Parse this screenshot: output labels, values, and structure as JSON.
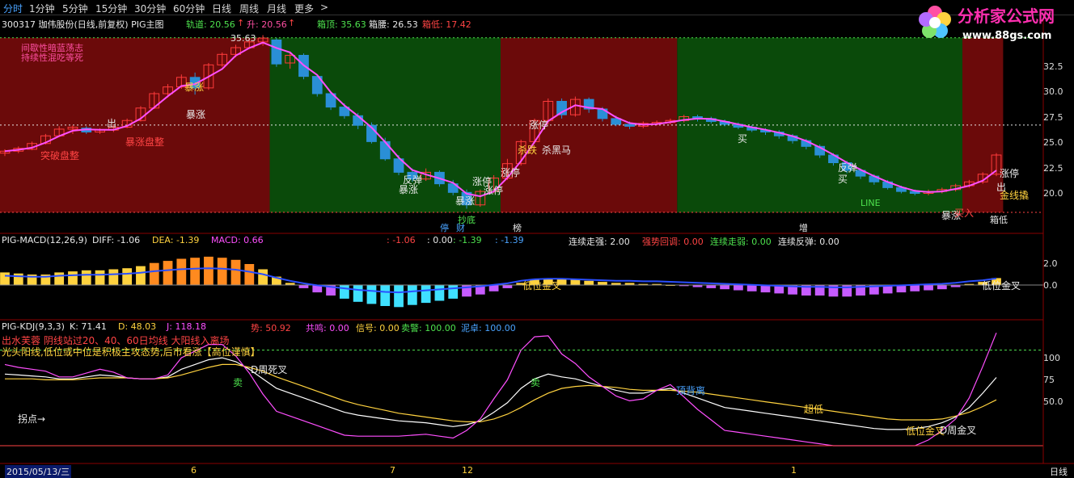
{
  "toolbar": {
    "items": [
      "分时",
      "1分钟",
      "5分钟",
      "15分钟",
      "30分钟",
      "60分钟",
      "日线",
      "周线",
      "月线",
      "更多"
    ],
    "active_index": 0,
    "more_arrow": ">"
  },
  "logo": {
    "brand": "分析家公式网",
    "url": "www.88gs.com"
  },
  "main_header": {
    "code_name": "300317 珈伟股份(日线,前复权) PIG主图",
    "track_label": "轨道: 20.56",
    "up_label": "升: 20.56",
    "box_top": "箱顶: 35.63",
    "box_mid": "箱腰: 26.53",
    "box_low": "箱低: 17.42",
    "up_arrow": "↑"
  },
  "macd_header": {
    "name": "PIG-MACD(12,26,9)",
    "diff": "DIFF: -1.06",
    "dea": "DEA: -1.39",
    "macd": "MACD: 0.66",
    "v1": ": -1.06",
    "v2": ": 0.00",
    "v3": ": -1.39",
    "v4": ": -1.39",
    "s1": "连续走强: 2.00",
    "s2": "强势回调: 0.00",
    "s3": "连续走弱: 0.00",
    "s4": "连续反弹: 0.00"
  },
  "kdj_header": {
    "name": "PIG-KDJ(9,3,3)",
    "k": "K: 71.41",
    "d": "D: 48.03",
    "j": "J: 118.18",
    "shi": "势: 50.92",
    "gongming": "共鸣: 0.00",
    "xinhao": "信号: 0.00",
    "maijing": "卖警: 100.00",
    "nizhuo": "泥卓: 100.00"
  },
  "main_annotations": {
    "intermittent1": "间歇性暗蓝荡志",
    "intermittent2": "持续性混吃等死",
    "breakout": "突破盘整",
    "surge_consol": "暴涨盘整",
    "out1": "出",
    "surge1": "暴涨",
    "surge_top": "暴涨",
    "peak": "35.63",
    "rebound": "反弹",
    "surge2": "暴涨",
    "surge3": "暴涨",
    "limit_up1": "涨停",
    "limit_up2": "涨停",
    "limit_up3": "涨停",
    "limit_up4": "涨停",
    "fall": "杀跌",
    "rebound_black": "杀黑马",
    "buy1": "买",
    "buy2": "买",
    "rebound2": "反弹",
    "line": "LINE",
    "surge4": "暴涨",
    "limit_up5": "涨停",
    "out2": "出",
    "cross": "金线撬",
    "box_low_lbl": "箱低",
    "bottom": "抄底",
    "ting": "停",
    "cai": "财",
    "bang": "榜",
    "zeng": "增",
    "buy_in": "买入"
  },
  "macd_annotations": {
    "low_gold": "低位金叉",
    "low_gold2": "低位金叉"
  },
  "kdj_annotations": {
    "note1": "出水芙蓉 阴线站过20、40、60日均线 大阳线入离场",
    "note2": "光头阳线,低位或中位是积极主攻态势,后市看涨【高位谨慎】",
    "d_death": "D周死叉",
    "sell1": "卖",
    "sell2": "卖",
    "top_div": "顶背离",
    "super_low": "超低",
    "low_gold": "低位金叉",
    "d_gold": "D周金叉",
    "turn": "拐点→"
  },
  "axes": {
    "price_ticks": [
      "32.5",
      "30.0",
      "27.5",
      "25.0",
      "22.5",
      "20.0"
    ],
    "macd_ticks": [
      "2.0",
      "0.0"
    ],
    "kdj_ticks": [
      "100",
      "75",
      "50.0"
    ],
    "date_labels": [
      "2015/05/13/三",
      "6",
      "7",
      "12",
      "1"
    ],
    "period": "日线"
  },
  "chart_data": {
    "type": "candlestick",
    "price_axis": {
      "min": 17,
      "max": 36.2,
      "ticks": [
        20.0,
        22.5,
        25.0,
        27.5,
        30.0,
        32.5
      ]
    },
    "levels": {
      "box_top": 35.63,
      "box_mid": 26.53,
      "box_low": 17.42
    },
    "candles": [
      [
        23.6,
        23.8,
        23.3,
        24.0
      ],
      [
        23.8,
        24.1,
        23.6,
        24.3
      ],
      [
        24.0,
        24.6,
        23.9,
        24.8
      ],
      [
        24.6,
        25.4,
        24.5,
        25.6
      ],
      [
        25.4,
        26.1,
        25.3,
        26.4
      ],
      [
        26.1,
        26.3,
        25.6,
        26.5
      ],
      [
        26.2,
        25.8,
        25.6,
        26.4
      ],
      [
        25.8,
        26.0,
        25.6,
        26.2
      ],
      [
        26.0,
        26.3,
        25.8,
        26.5
      ],
      [
        26.3,
        27.0,
        26.2,
        27.2
      ],
      [
        27.0,
        28.3,
        26.9,
        28.5
      ],
      [
        28.3,
        29.8,
        28.2,
        30.0
      ],
      [
        29.8,
        30.5,
        29.4,
        30.8
      ],
      [
        30.5,
        31.5,
        30.3,
        31.8
      ],
      [
        31.5,
        30.4,
        29.7,
        32.0
      ],
      [
        30.4,
        32.8,
        30.2,
        33.0
      ],
      [
        32.8,
        33.9,
        32.6,
        34.1
      ],
      [
        33.9,
        34.6,
        33.6,
        34.9
      ],
      [
        34.6,
        35.2,
        34.5,
        35.6
      ],
      [
        35.2,
        35.6,
        34.8,
        35.9
      ],
      [
        35.4,
        32.9,
        32.6,
        35.6
      ],
      [
        33.0,
        33.8,
        32.4,
        34.2
      ],
      [
        33.8,
        31.6,
        31.3,
        34.0
      ],
      [
        31.6,
        29.8,
        29.5,
        31.8
      ],
      [
        29.8,
        28.4,
        28.1,
        30.0
      ],
      [
        28.4,
        27.5,
        27.2,
        28.8
      ],
      [
        27.5,
        26.5,
        26.1,
        27.8
      ],
      [
        26.5,
        24.8,
        24.6,
        26.8
      ],
      [
        24.8,
        23.0,
        22.8,
        25.2
      ],
      [
        23.0,
        21.6,
        21.3,
        23.4
      ],
      [
        21.6,
        20.9,
        20.6,
        22.0
      ],
      [
        20.9,
        21.6,
        20.7,
        22.0
      ],
      [
        21.6,
        20.4,
        20.1,
        21.8
      ],
      [
        20.4,
        19.5,
        19.2,
        20.8
      ],
      [
        19.5,
        18.2,
        17.8,
        19.8
      ],
      [
        18.2,
        19.6,
        18.0,
        19.8
      ],
      [
        19.6,
        21.0,
        19.4,
        21.3
      ],
      [
        21.0,
        22.5,
        20.8,
        23.0
      ],
      [
        22.5,
        24.8,
        22.3,
        25.0
      ],
      [
        24.8,
        27.0,
        24.6,
        27.2
      ],
      [
        27.0,
        29.0,
        26.6,
        29.3
      ],
      [
        29.0,
        27.6,
        27.2,
        29.3
      ],
      [
        27.6,
        29.2,
        27.4,
        29.5
      ],
      [
        29.2,
        28.2,
        27.8,
        29.4
      ],
      [
        28.2,
        27.2,
        26.9,
        28.4
      ],
      [
        27.2,
        26.6,
        26.4,
        27.5
      ],
      [
        26.6,
        26.4,
        26.1,
        26.9
      ],
      [
        26.4,
        26.7,
        26.2,
        26.9
      ],
      [
        26.7,
        26.8,
        26.5,
        27.0
      ],
      [
        26.8,
        27.0,
        26.6,
        27.2
      ],
      [
        27.0,
        27.4,
        26.8,
        27.6
      ],
      [
        27.4,
        27.2,
        26.9,
        27.6
      ],
      [
        27.2,
        26.9,
        26.7,
        27.4
      ],
      [
        26.9,
        26.6,
        26.4,
        27.1
      ],
      [
        26.6,
        26.3,
        26.1,
        26.8
      ],
      [
        26.3,
        26.0,
        25.8,
        26.5
      ],
      [
        26.0,
        25.8,
        25.5,
        26.2
      ],
      [
        25.8,
        25.4,
        25.1,
        26.0
      ],
      [
        25.4,
        24.9,
        24.6,
        25.6
      ],
      [
        24.9,
        24.3,
        24.0,
        25.1
      ],
      [
        24.3,
        23.4,
        23.1,
        24.5
      ],
      [
        23.4,
        22.6,
        22.3,
        23.6
      ],
      [
        22.6,
        21.8,
        21.5,
        22.8
      ],
      [
        21.8,
        21.2,
        20.9,
        22.0
      ],
      [
        21.2,
        20.6,
        20.3,
        21.4
      ],
      [
        20.6,
        20.0,
        19.8,
        20.8
      ],
      [
        20.0,
        19.6,
        19.4,
        20.2
      ],
      [
        19.6,
        19.4,
        19.2,
        19.8
      ],
      [
        19.4,
        19.6,
        19.2,
        19.8
      ],
      [
        19.6,
        19.8,
        19.4,
        20.0
      ],
      [
        19.8,
        20.2,
        19.6,
        20.4
      ],
      [
        20.2,
        20.6,
        20.0,
        20.8
      ],
      [
        20.6,
        21.4,
        20.4,
        21.6
      ],
      [
        21.4,
        23.4,
        21.2,
        23.6
      ]
    ],
    "macd": [
      1.2,
      1.1,
      1.0,
      1.0,
      1.2,
      1.3,
      1.4,
      1.4,
      1.5,
      1.6,
      1.8,
      2.1,
      2.3,
      2.5,
      2.6,
      2.7,
      2.6,
      2.4,
      2.0,
      1.5,
      0.8,
      0.2,
      -0.3,
      -0.7,
      -1.0,
      -1.3,
      -1.6,
      -1.8,
      -2.0,
      -2.1,
      -1.9,
      -1.7,
      -1.5,
      -1.3,
      -1.1,
      -0.9,
      -0.6,
      -0.3,
      0.2,
      0.5,
      0.6,
      0.6,
      0.5,
      0.4,
      0.3,
      0.2,
      0.2,
      0.1,
      0.1,
      0.0,
      -0.1,
      -0.2,
      -0.3,
      -0.4,
      -0.5,
      -0.6,
      -0.7,
      -0.8,
      -0.9,
      -1.0,
      -1.0,
      -1.1,
      -1.1,
      -1.0,
      -0.9,
      -0.8,
      -0.7,
      -0.6,
      -0.5,
      -0.4,
      -0.2,
      0.1,
      0.3,
      0.66
    ],
    "kdj_k": [
      75,
      74,
      73,
      72,
      70,
      70,
      72,
      74,
      73,
      71,
      70,
      70,
      72,
      80,
      85,
      90,
      92,
      88,
      80,
      70,
      60,
      55,
      50,
      45,
      40,
      35,
      32,
      30,
      28,
      26,
      25,
      24,
      22,
      20,
      22,
      26,
      35,
      45,
      60,
      70,
      75,
      72,
      70,
      66,
      62,
      58,
      55,
      55,
      58,
      60,
      55,
      50,
      45,
      40,
      38,
      36,
      34,
      32,
      30,
      28,
      26,
      24,
      22,
      20,
      18,
      17,
      17,
      18,
      20,
      24,
      30,
      40,
      55,
      71.41
    ],
    "kdj_d": [
      70,
      70,
      70,
      69,
      69,
      69,
      70,
      71,
      71,
      71,
      70,
      70,
      71,
      74,
      78,
      82,
      85,
      85,
      82,
      78,
      72,
      67,
      62,
      57,
      52,
      47,
      43,
      40,
      37,
      34,
      32,
      30,
      28,
      26,
      25,
      25,
      28,
      33,
      40,
      48,
      55,
      60,
      62,
      63,
      62,
      61,
      59,
      58,
      58,
      58,
      57,
      56,
      54,
      52,
      50,
      48,
      46,
      44,
      42,
      40,
      38,
      36,
      34,
      32,
      30,
      28,
      27,
      27,
      27,
      28,
      31,
      35,
      41,
      48.03
    ],
    "kdj_j": [
      85,
      82,
      80,
      78,
      72,
      72,
      76,
      80,
      77,
      71,
      70,
      70,
      74,
      92,
      99,
      106,
      106,
      94,
      76,
      54,
      36,
      31,
      26,
      21,
      16,
      11,
      10,
      10,
      10,
      10,
      11,
      12,
      10,
      8,
      16,
      28,
      49,
      69,
      100,
      114,
      115,
      96,
      86,
      72,
      62,
      52,
      47,
      49,
      58,
      64,
      51,
      38,
      27,
      16,
      14,
      12,
      10,
      8,
      6,
      4,
      2,
      0,
      0,
      0,
      0,
      0,
      0,
      0,
      6,
      16,
      28,
      50,
      83,
      118.18
    ]
  }
}
